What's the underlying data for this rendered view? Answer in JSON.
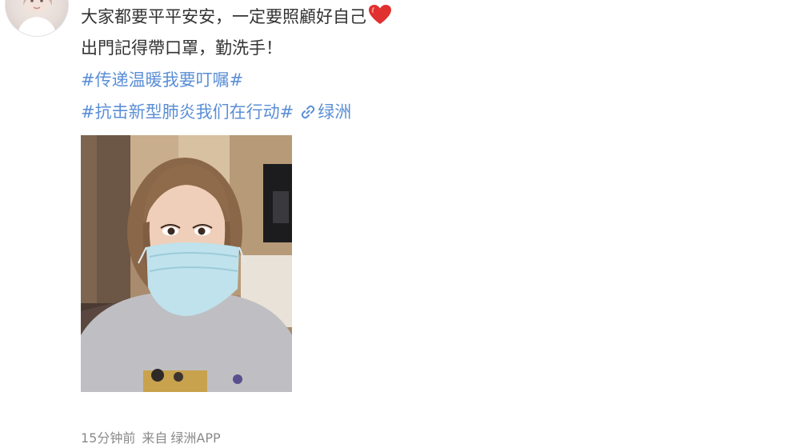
{
  "post": {
    "line1": "大家都要平平安安，一定要照顧好自己",
    "line2": "出門記得帶口罩，勤洗手！",
    "topic1": "#传递温暖我要叮嘱#",
    "topic2": "#抗击新型肺炎我们在行动#",
    "location": "绿洲",
    "icons": {
      "heart": "heart-icon",
      "link": "link-icon"
    },
    "colors": {
      "text": "#333333",
      "link": "#5b8fd6",
      "meta": "#8a8a8a",
      "heart": "#e0302f"
    }
  },
  "meta": {
    "time": "15分钟前",
    "source_label": "来自",
    "source_app": "绿洲APP"
  }
}
